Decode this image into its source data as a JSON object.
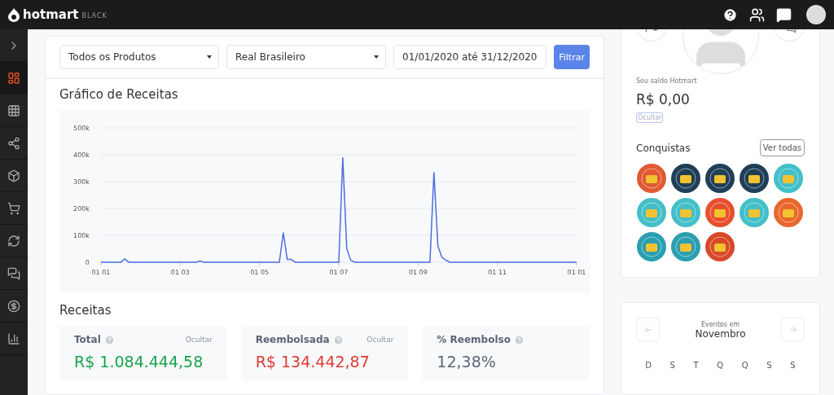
{
  "header": {
    "logo_text": "hotmart",
    "logo_badge": "BLACK"
  },
  "sidebar": {
    "items": [
      {
        "selected": true
      },
      {
        "selected": false
      },
      {
        "selected": false
      },
      {
        "selected": false
      },
      {
        "selected": false
      },
      {
        "selected": false
      },
      {
        "selected": false
      },
      {
        "selected": false
      },
      {
        "selected": false
      }
    ]
  },
  "filters": {
    "product": "Todos os Produtos",
    "currency": "Real Brasileiro",
    "date_range": "01/01/2020 até 31/12/2020",
    "button": "Filtrar"
  },
  "revenue_chart": {
    "title": "Gráfico de Receitas",
    "chart_data": {
      "type": "line",
      "grid": true,
      "ylim": [
        0,
        500000
      ],
      "yticks": [
        {
          "value": 0,
          "label": "0"
        },
        {
          "value": 100000,
          "label": "100k"
        },
        {
          "value": 200000,
          "label": "200k"
        },
        {
          "value": 300000,
          "label": "300k"
        },
        {
          "value": 400000,
          "label": "400k"
        },
        {
          "value": 500000,
          "label": "500k"
        }
      ],
      "categories": [
        "01 01",
        null,
        null,
        null,
        null,
        null,
        null,
        null,
        null,
        null,
        null,
        null,
        null,
        null,
        null,
        null,
        null,
        null,
        null,
        null,
        "01 03",
        null,
        null,
        null,
        null,
        null,
        null,
        null,
        null,
        null,
        null,
        null,
        null,
        null,
        null,
        null,
        null,
        null,
        null,
        null,
        "01 05",
        null,
        null,
        null,
        null,
        null,
        null,
        null,
        null,
        null,
        null,
        null,
        null,
        null,
        null,
        null,
        null,
        null,
        null,
        null,
        "01 07",
        null,
        null,
        null,
        null,
        null,
        null,
        null,
        null,
        null,
        null,
        null,
        null,
        null,
        null,
        null,
        null,
        null,
        null,
        null,
        "01 09",
        null,
        null,
        null,
        null,
        null,
        null,
        null,
        null,
        null,
        null,
        null,
        null,
        null,
        null,
        null,
        null,
        null,
        null,
        null,
        "01 11",
        null,
        null,
        null,
        null,
        null,
        null,
        null,
        null,
        null,
        null,
        null,
        null,
        null,
        null,
        null,
        null,
        null,
        null,
        null,
        "01 01"
      ],
      "series": [
        {
          "color": "#4a6fe0",
          "values": [
            0,
            0,
            0,
            0,
            0,
            0,
            12000,
            0,
            0,
            0,
            0,
            0,
            0,
            0,
            0,
            0,
            0,
            0,
            0,
            0,
            0,
            0,
            0,
            0,
            0,
            4000,
            0,
            0,
            0,
            0,
            0,
            0,
            0,
            0,
            0,
            0,
            0,
            0,
            0,
            0,
            0,
            0,
            0,
            0,
            0,
            0,
            110000,
            10000,
            10000,
            0,
            0,
            0,
            0,
            0,
            0,
            0,
            0,
            0,
            0,
            0,
            0,
            390000,
            50000,
            8000,
            0,
            0,
            0,
            0,
            0,
            0,
            0,
            0,
            0,
            0,
            0,
            0,
            0,
            0,
            0,
            0,
            0,
            0,
            0,
            0,
            335000,
            60000,
            18000,
            8000,
            0,
            0,
            0,
            0,
            0,
            0,
            0,
            0,
            0,
            0,
            0,
            0,
            0,
            0,
            0,
            0,
            0,
            0,
            0,
            0,
            0,
            0,
            0,
            0,
            0,
            0,
            0,
            0,
            0,
            0,
            0,
            0,
            0
          ]
        }
      ]
    }
  },
  "revenue": {
    "title": "Receitas",
    "stats": [
      {
        "label": "Total",
        "hide": "Ocultar",
        "value": "R$ 1.084.444,58",
        "color": "#1aa34a"
      },
      {
        "label": "Reembolsada",
        "hide": "Ocultar",
        "value": "R$ 134.442,87",
        "color": "#de3b37"
      },
      {
        "label": "% Reembolso",
        "value": "12,38%",
        "color": "#5d6675"
      }
    ]
  },
  "profile": {
    "balance_label": "Seu saldo Hotmart",
    "balance": "R$ 0,00",
    "hide": "Ocultar",
    "achievements_title": "Conquistas",
    "see_all": "Ver todas",
    "badges": [
      {
        "color": "#e05a33"
      },
      {
        "color": "#1f3f57"
      },
      {
        "color": "#1f3f57"
      },
      {
        "color": "#1f3f57"
      },
      {
        "color": "#43bfc8"
      },
      {
        "color": "#43bfc8"
      },
      {
        "color": "#43bfc8"
      },
      {
        "color": "#e8502c"
      },
      {
        "color": "#43bfc8"
      },
      {
        "color": "#e8672c"
      },
      {
        "color": "#2a9fb0"
      },
      {
        "color": "#2a9fb0"
      },
      {
        "color": "#d8482a"
      }
    ]
  },
  "events": {
    "caption": "Eventos em",
    "month": "Novembro",
    "weekdays": [
      "D",
      "S",
      "T",
      "Q",
      "Q",
      "S",
      "S"
    ]
  }
}
